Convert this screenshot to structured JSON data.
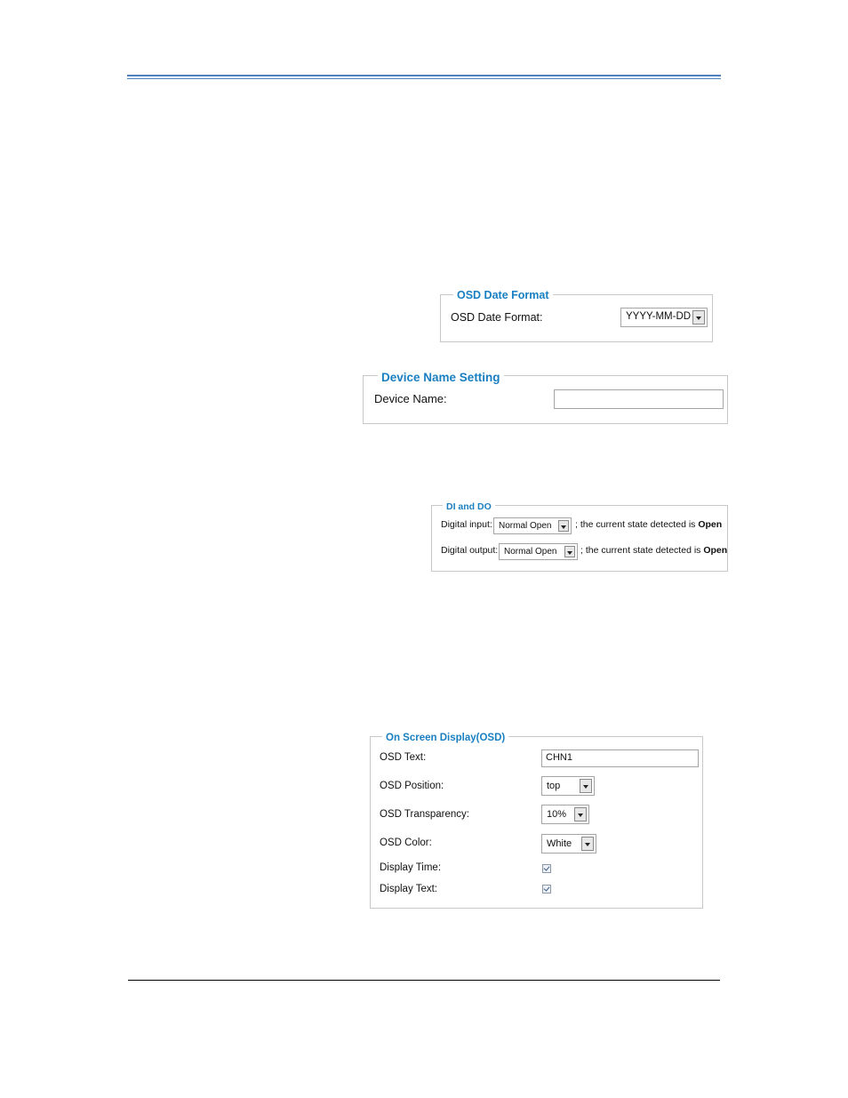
{
  "osd_date": {
    "legend": "OSD Date Format",
    "label": "OSD Date Format:",
    "value": "YYYY-MM-DD"
  },
  "device_name": {
    "legend": "Device Name Setting",
    "label": "Device Name:",
    "value": ""
  },
  "dido": {
    "legend": "DI and DO",
    "input_label": "Digital input:",
    "input_value": "Normal Open",
    "input_text": "; the current state detected is",
    "input_state": "Open",
    "output_label": "Digital output:",
    "output_value": "Normal Open",
    "output_text": "; the current state detected is",
    "output_state": "Open"
  },
  "osd": {
    "legend": "On Screen Display(OSD)",
    "text_label": "OSD Text:",
    "text_value": "CHN1",
    "position_label": "OSD Position:",
    "position_value": "top",
    "transparency_label": "OSD Transparency:",
    "transparency_value": "10%",
    "color_label": "OSD Color:",
    "color_value": "White",
    "display_time_label": "Display Time:",
    "display_time_checked": true,
    "display_text_label": "Display Text:",
    "display_text_checked": true
  },
  "colors": {
    "legend": "#1a7fc1",
    "header_rule": "#4f81bd",
    "panel_border": "#c8c8c8"
  }
}
